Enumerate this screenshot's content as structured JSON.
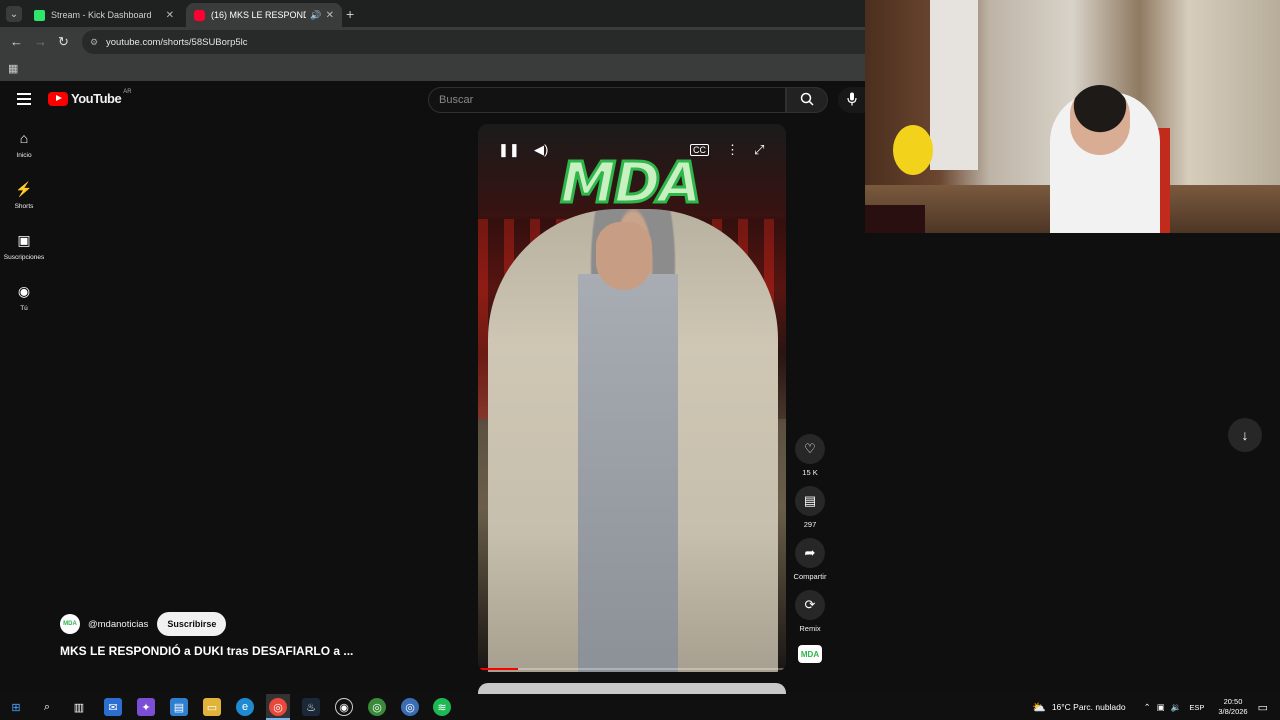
{
  "browser": {
    "tabs": [
      {
        "title": "Stream - Kick Dashboard",
        "active": false
      },
      {
        "title": "(16) MKS LE RESPONDIÓ a",
        "active": true
      }
    ],
    "url": "youtube.com/shorts/58SUBorp5lc"
  },
  "youtube": {
    "logo_text": "YouTube",
    "country": "AR",
    "search_placeholder": "Buscar",
    "sidebar": [
      {
        "label": "Inicio",
        "icon": "home-icon"
      },
      {
        "label": "Shorts",
        "icon": "shorts-icon"
      },
      {
        "label": "Suscripciones",
        "icon": "subscriptions-icon"
      },
      {
        "label": "Tú",
        "icon": "user-icon"
      }
    ],
    "video": {
      "overlay_text": "MDA",
      "progress": 0.13
    },
    "actions": {
      "likes": "15 K",
      "comments": "297",
      "share": "Compartir",
      "remix": "Remix"
    },
    "channel": {
      "handle": "@mdanoticias",
      "avatar_text": "MDA",
      "subscribe_label": "Suscribirse"
    },
    "title": "MKS LE RESPONDIÓ a DUKI tras DESAFIARLO a ..."
  },
  "taskbar": {
    "weather": "16°C  Parc. nublado",
    "language": "ESP",
    "time": "20:50",
    "date": "3/8/2026"
  }
}
